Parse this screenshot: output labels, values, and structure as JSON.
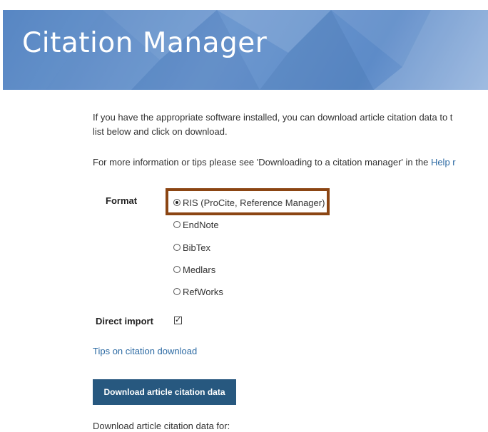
{
  "banner": {
    "title": "Citation Manager"
  },
  "intro": {
    "line1": "If you have the appropriate software installed, you can download article citation data to t",
    "line2": "list below and click on download.",
    "more_prefix": "For more information or tips please see 'Downloading to a citation manager' in the ",
    "more_link": "Help r"
  },
  "format": {
    "label": "Format",
    "options": [
      {
        "label": "RIS (ProCite, Reference Manager)",
        "selected": true
      },
      {
        "label": "EndNote",
        "selected": false
      },
      {
        "label": "BibTex",
        "selected": false
      },
      {
        "label": "Medlars",
        "selected": false
      },
      {
        "label": "RefWorks",
        "selected": false
      }
    ]
  },
  "direct_import": {
    "label": "Direct import",
    "checked": true,
    "check_glyph": "✓"
  },
  "tips_link": "Tips on citation download",
  "download_button": "Download article citation data",
  "download_for": "Download article citation data for:",
  "colors": {
    "banner": "#5d8bc8",
    "button": "#27587f",
    "link": "#2c6aa3",
    "highlight": "#8b4513"
  }
}
